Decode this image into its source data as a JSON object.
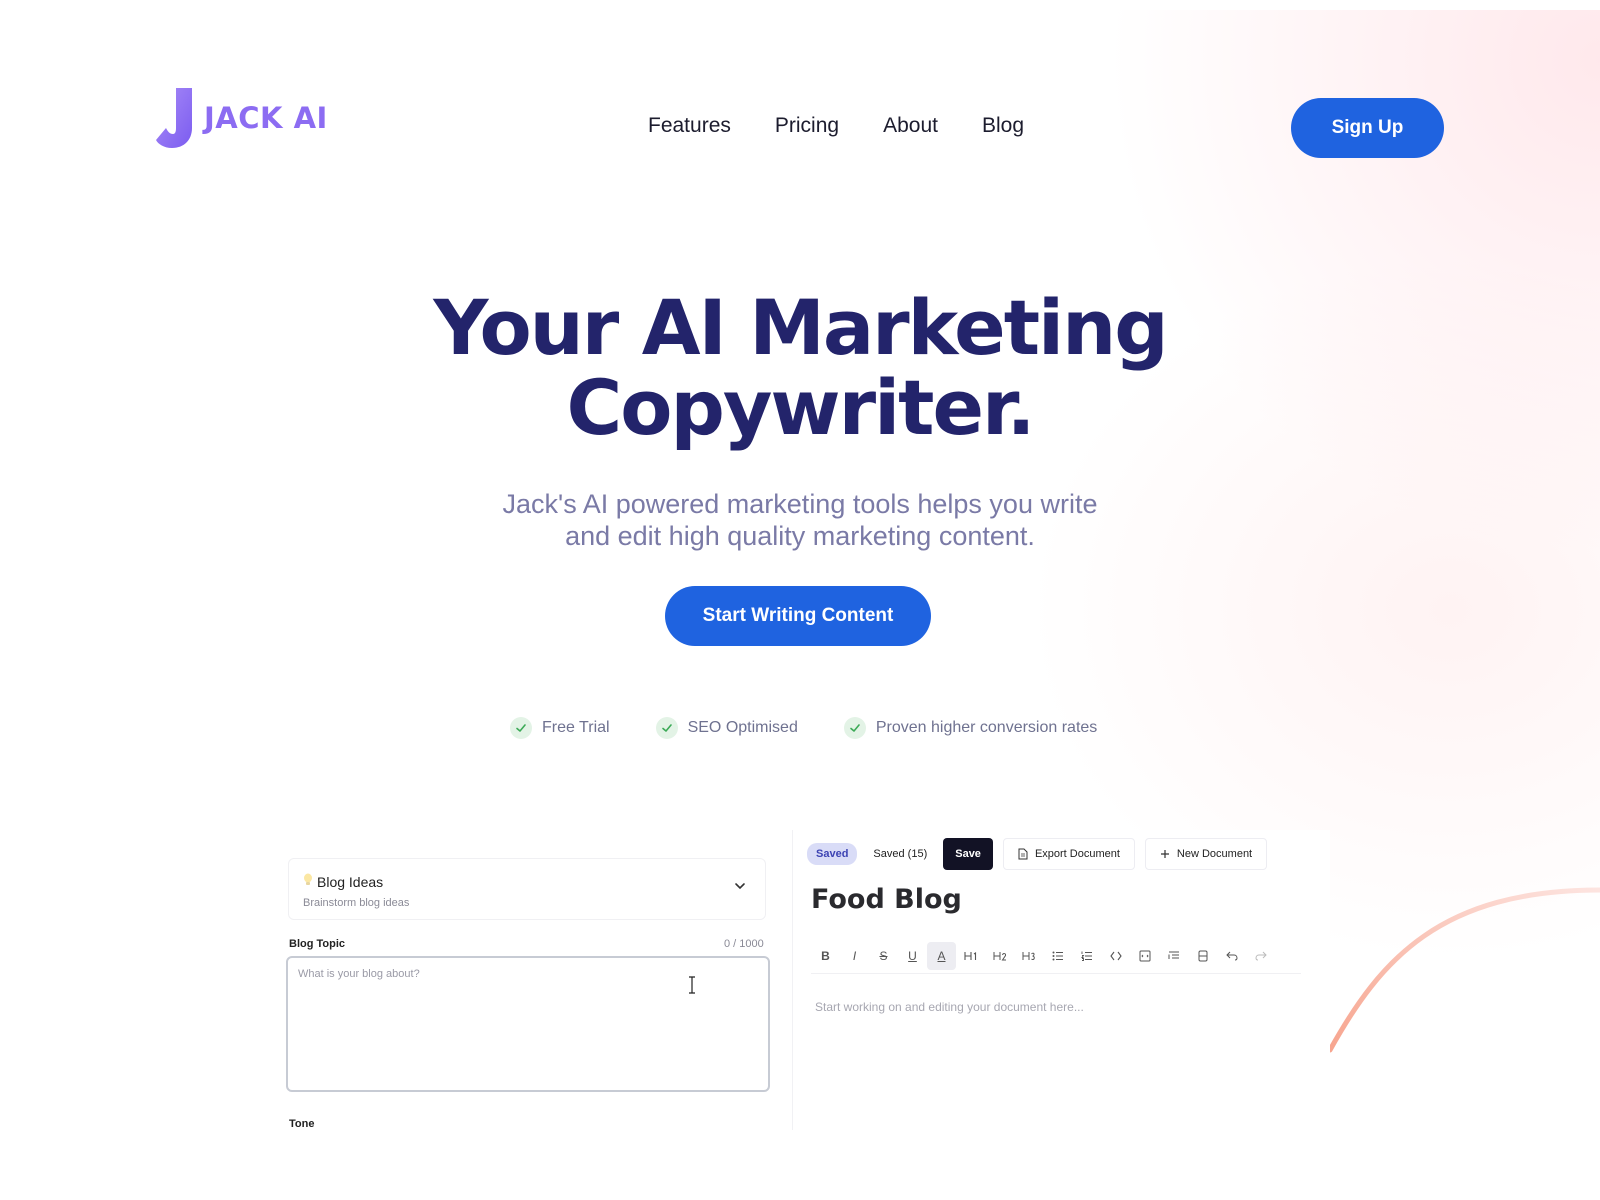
{
  "brand": {
    "name": "JACK AI",
    "logo_color": "#8c6cf2"
  },
  "nav": {
    "items": [
      "Features",
      "Pricing",
      "About",
      "Blog"
    ]
  },
  "header": {
    "signup_label": "Sign Up"
  },
  "hero": {
    "title_line1": "Your AI Marketing",
    "title_line2": "Copywriter.",
    "subtitle_line1": "Jack's AI powered marketing tools helps you write",
    "subtitle_line2": "and edit high quality marketing content.",
    "cta_label": "Start Writing Content"
  },
  "features": [
    "Free Trial",
    "SEO Optimised",
    "Proven higher conversion rates"
  ],
  "app": {
    "left": {
      "tool_name": "Blog Ideas",
      "tool_description": "Brainstorm blog ideas",
      "field_label": "Blog Topic",
      "field_count": "0 / 1000",
      "field_placeholder": "What is your blog about?",
      "tone_label": "Tone"
    },
    "right": {
      "status_badge": "Saved",
      "saved_count": "Saved (15)",
      "save_label": "Save",
      "export_label": "Export Document",
      "new_label": "New Document",
      "doc_title": "Food Blog",
      "doc_placeholder": "Start working on and editing your document here..."
    }
  },
  "colors": {
    "primary": "#1f63e0",
    "heading": "#23246b",
    "subtext": "#7a7aa6",
    "check_bg": "#e3f3e6"
  }
}
